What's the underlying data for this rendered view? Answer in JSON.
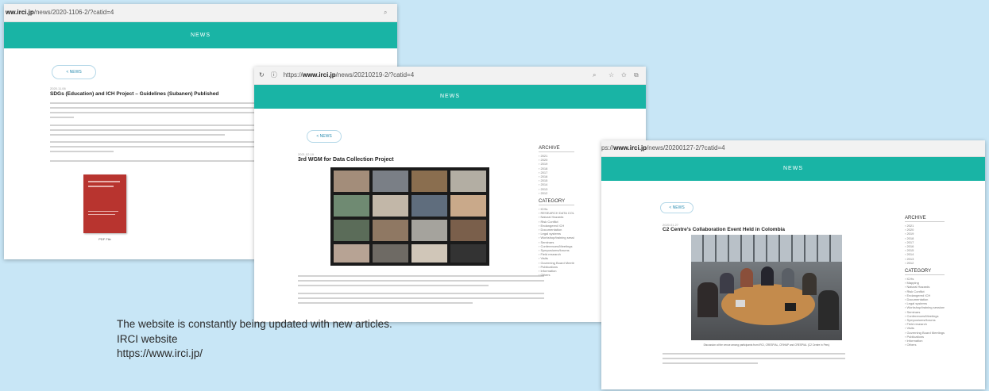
{
  "screenshot1": {
    "url_host": "ww.irci.jp",
    "url_path": "/news/2020-1106-2/?catid=4",
    "band_label": "NEWS",
    "back_label": "< NEWS",
    "date": "2020.11.06",
    "title": "SDGs (Education) and ICH Project – Guidelines (Subanen) Published",
    "book_caption": "PDF File"
  },
  "screenshot2": {
    "url_prefix": "https://",
    "url_host": "www.irci.jp",
    "url_path": "/news/20210219-2/?catid=4",
    "band_label": "NEWS",
    "back_label": "< NEWS",
    "date": "2021.02.19",
    "title": "3rd WGM for Data Collection Project",
    "archive_heading": "ARCHIVE",
    "archive_items": [
      "2021",
      "2020",
      "2019",
      "2018",
      "2017",
      "2016",
      "2015",
      "2014",
      "2013",
      "2012"
    ],
    "category_heading": "CATEGORY",
    "category_items": [
      "ICHs",
      "RESEARCH DATA COLLECTION",
      "Natural Hazards",
      "Risk Conflict",
      "Endangered ICH",
      "Documentation",
      "Legal systems",
      "Workshop/training sessions",
      "Seminars",
      "Conferences/Meetings",
      "Symposiums/forums",
      "Field research",
      "Visits",
      "Governing Board Meetings",
      "Publications",
      "Information",
      "Others"
    ]
  },
  "screenshot3": {
    "url_prefix": "ps://",
    "url_host": "www.irci.jp",
    "url_path": "/news/20200127-2/?catid=4",
    "band_label": "NEWS",
    "back_label": "< NEWS",
    "date": "2020.01.27",
    "title": "C2 Centre’s Collaboration Event Held in Colombia",
    "photo_caption": "Discussion at the venue among participants from IRCI, CRESPIAL, CRIHAP and CRESPIAL (C2 Centre in Peru)",
    "archive_heading": "ARCHIVE",
    "archive_items": [
      "2021",
      "2020",
      "2019",
      "2018",
      "2017",
      "2016",
      "2015",
      "2014",
      "2013",
      "2012"
    ],
    "category_heading": "CATEGORY",
    "category_items": [
      "ICHs",
      "Mapping",
      "Natural Hazards",
      "Risk Conflict",
      "Endangered ICH",
      "Documentation",
      "Legal systems",
      "Workshop/training sessions",
      "Seminars",
      "Conferences/Meetings",
      "Symposiums/forums",
      "Field research",
      "Visits",
      "Governing Board Meetings",
      "Publications",
      "Information",
      "Others"
    ]
  },
  "caption": {
    "line1": "The website is constantly being updated with new articles.",
    "line2": "IRCI website",
    "line3": "https://www.irci.jp/"
  },
  "colors": {
    "band": "#19b4a5",
    "background": "#c8e6f6",
    "book": "#b8342f"
  }
}
